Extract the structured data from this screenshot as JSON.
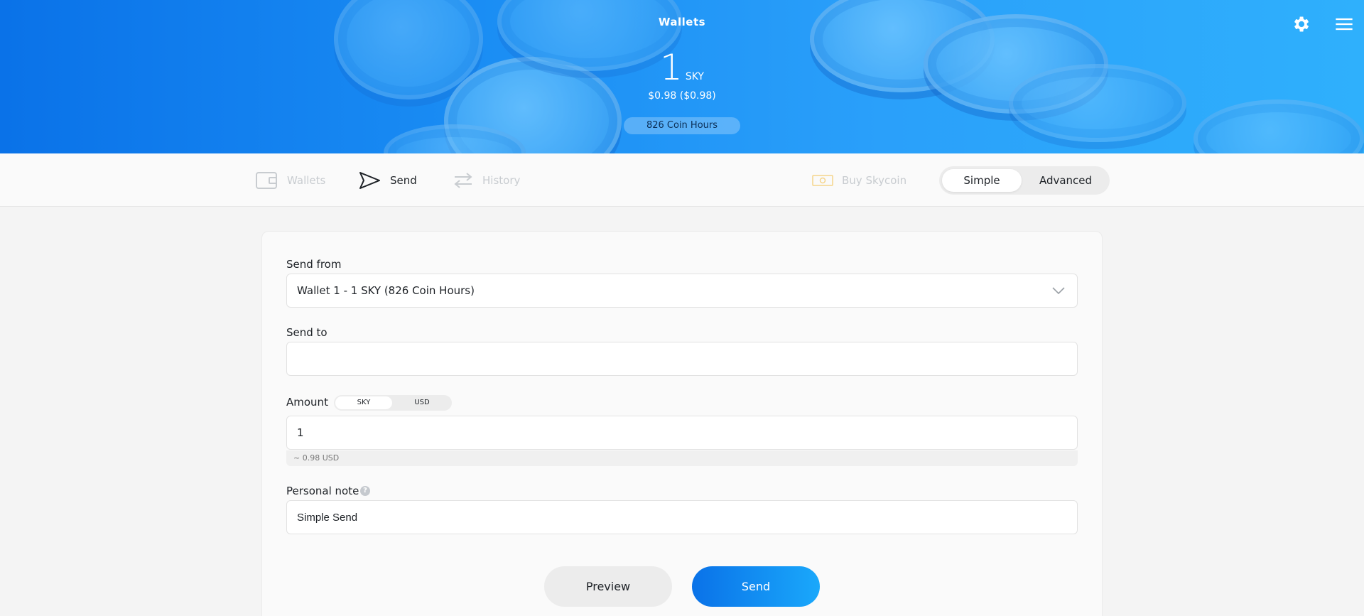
{
  "header": {
    "title": "Wallets",
    "balance": "1",
    "unit": "SKY",
    "usd": "$0.98 ($0.98)",
    "coin_hours": "826 Coin Hours",
    "settings_icon": "gear-icon",
    "menu_icon": "hamburger-menu-icon"
  },
  "nav": {
    "wallets": "Wallets",
    "send": "Send",
    "history": "History",
    "buy": "Buy Skycoin",
    "active": "send"
  },
  "mode": {
    "simple": "Simple",
    "advanced": "Advanced",
    "selected": "simple"
  },
  "form": {
    "send_from_label": "Send from",
    "send_from_value": "Wallet 1 - 1 SKY (826 Coin Hours)",
    "send_to_label": "Send to",
    "send_to_value": "",
    "amount_label": "Amount",
    "unit_sky": "SKY",
    "unit_usd": "USD",
    "unit_selected": "SKY",
    "amount_value": "1",
    "conversion": "~ 0.98 USD",
    "note_label": "Personal note",
    "note_value": "Simple Send",
    "help_glyph": "?"
  },
  "buttons": {
    "preview": "Preview",
    "send": "Send"
  },
  "colors": {
    "accent": "#0a72e8",
    "accent_light": "#1aa8fb",
    "text": "#1e2227",
    "muted": "#c8ccd0"
  }
}
